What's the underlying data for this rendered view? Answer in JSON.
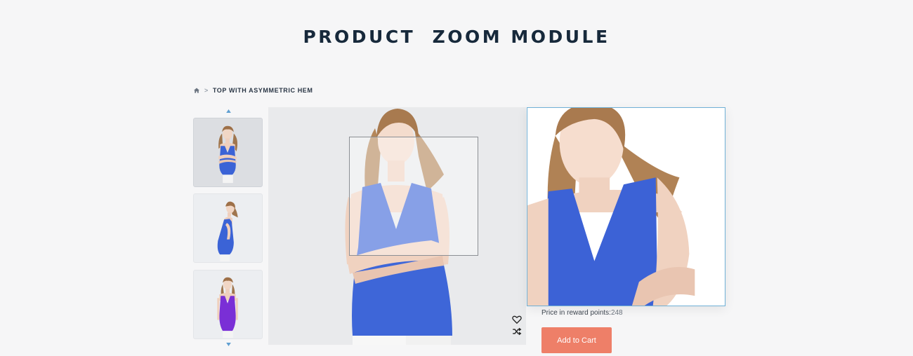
{
  "page": {
    "title": "PRODUCT  ZOOM MODULE"
  },
  "breadcrumb": {
    "home_icon": "home-icon",
    "separator": ">",
    "current": "TOP WITH ASYMMETRIC HEM"
  },
  "thumbnails": {
    "up_icon": "triangle-up-icon",
    "down_icon": "triangle-down-icon",
    "items": [
      {
        "name": "thumb-front-blue",
        "top_color": "#3b63d6",
        "active": true
      },
      {
        "name": "thumb-side-blue",
        "top_color": "#3b63d6",
        "active": false
      },
      {
        "name": "thumb-front-purple",
        "top_color": "#7a2fd6",
        "active": false
      }
    ]
  },
  "main_image": {
    "top_color": "#3e66d8",
    "wishlist_icon": "heart-icon",
    "compare_icon": "shuffle-icon"
  },
  "zoom": {
    "top_color": "#3c62d6"
  },
  "product": {
    "reward_label": "Price in reward points:",
    "reward_value": "248",
    "add_to_cart_label": "Add to Cart"
  },
  "colors": {
    "accent": "#ee7f68",
    "zoom_border": "#6fb0d6",
    "title": "#17293b"
  }
}
